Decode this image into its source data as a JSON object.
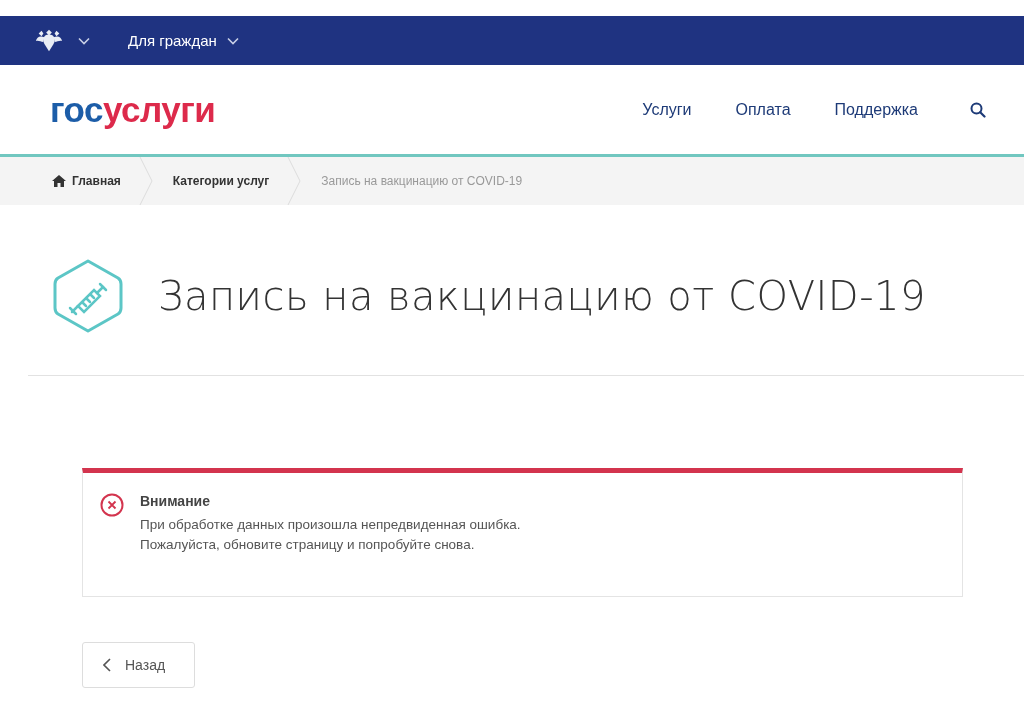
{
  "top_bar": {
    "emblem_menu": {
      "expanded": false
    },
    "audience_menu": {
      "label": "Для граждан",
      "expanded": false
    }
  },
  "header": {
    "logo": {
      "part_1": "гос",
      "part_2": "услуги"
    },
    "nav": [
      "Услуги",
      "Оплата",
      "Поддержка"
    ]
  },
  "breadcrumbs": [
    {
      "label": "Главная",
      "kind": "home",
      "current": false
    },
    {
      "label": "Категории услуг",
      "kind": "link",
      "current": false
    },
    {
      "label": "Запись на вакцинацию от COVID-19",
      "kind": "link",
      "current": true
    }
  ],
  "page_title": "Запись на вакцинацию от COVID-19",
  "alert": {
    "kind": "error",
    "title": "Внимание",
    "lines": [
      "При обработке данных произошла непредвиденная ошибка.",
      "Пожалуйста, обновите страницу и попробуйте снова."
    ]
  },
  "back_button": {
    "label": "Назад"
  }
}
